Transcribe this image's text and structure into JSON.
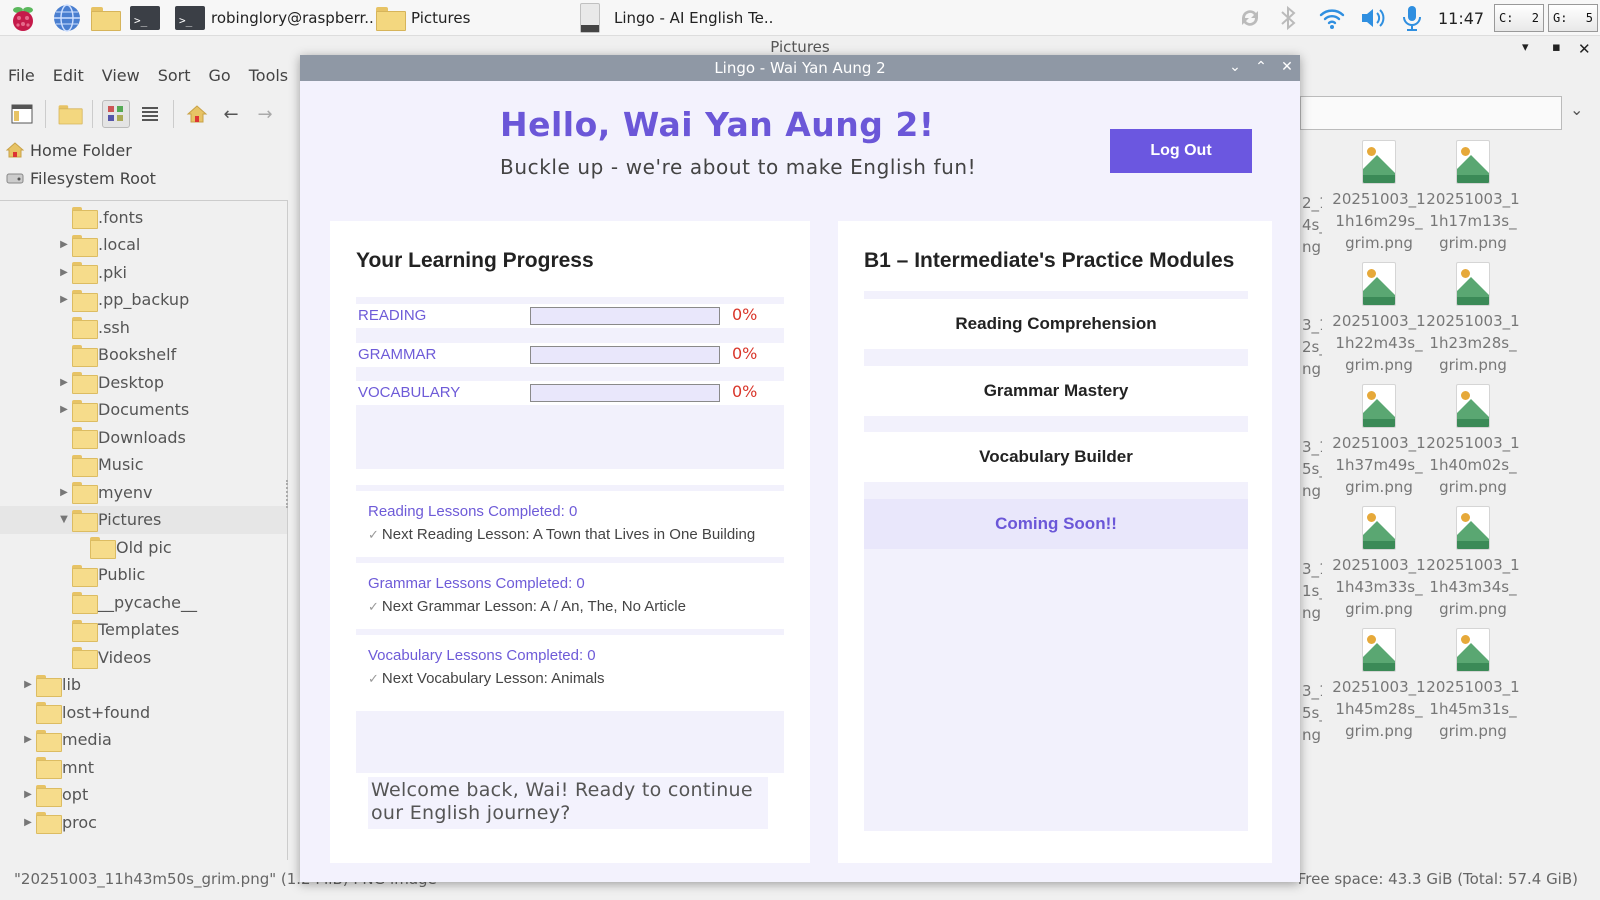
{
  "taskbar": {
    "terminal_label": "robinglory@raspberr..",
    "pictures_label": "Pictures",
    "lingo_label": "Lingo - AI English Te..",
    "clock": "11:47",
    "cpu_label": "C:",
    "cpu_value": "2",
    "gpu_label": "G:",
    "gpu_value": "5"
  },
  "file_manager": {
    "title": "Pictures",
    "menu": [
      "File",
      "Edit",
      "View",
      "Sort",
      "Go",
      "Tools"
    ],
    "places": [
      "Home Folder",
      "Filesystem Root"
    ],
    "tree": [
      {
        "label": ".fonts",
        "indent": 2,
        "expandable": false
      },
      {
        "label": ".local",
        "indent": 2,
        "expandable": true
      },
      {
        "label": ".pki",
        "indent": 2,
        "expandable": true
      },
      {
        "label": ".pp_backup",
        "indent": 2,
        "expandable": true
      },
      {
        "label": ".ssh",
        "indent": 2,
        "expandable": false
      },
      {
        "label": "Bookshelf",
        "indent": 2,
        "expandable": false
      },
      {
        "label": "Desktop",
        "indent": 2,
        "expandable": true
      },
      {
        "label": "Documents",
        "indent": 2,
        "expandable": true
      },
      {
        "label": "Downloads",
        "indent": 2,
        "expandable": false
      },
      {
        "label": "Music",
        "indent": 2,
        "expandable": false
      },
      {
        "label": "myenv",
        "indent": 2,
        "expandable": true
      },
      {
        "label": "Pictures",
        "indent": 2,
        "expandable": true,
        "expanded": true,
        "selected": true
      },
      {
        "label": "Old pic",
        "indent": 3,
        "expandable": false
      },
      {
        "label": "Public",
        "indent": 2,
        "expandable": false
      },
      {
        "label": "__pycache__",
        "indent": 2,
        "expandable": false
      },
      {
        "label": "Templates",
        "indent": 2,
        "expandable": false
      },
      {
        "label": "Videos",
        "indent": 2,
        "expandable": false
      },
      {
        "label": "lib",
        "indent": 1,
        "expandable": true
      },
      {
        "label": "lost+found",
        "indent": 1,
        "expandable": false
      },
      {
        "label": "media",
        "indent": 1,
        "expandable": true
      },
      {
        "label": "mnt",
        "indent": 1,
        "expandable": false
      },
      {
        "label": "opt",
        "indent": 1,
        "expandable": true
      },
      {
        "label": "proc",
        "indent": 1,
        "expandable": true
      }
    ],
    "files": [
      [
        "20251003_1",
        "1h16m29s_",
        "grim.png"
      ],
      [
        "20251003_1",
        "1h17m13s_",
        "grim.png"
      ],
      [
        "20251003_1",
        "1h22m43s_",
        "grim.png"
      ],
      [
        "20251003_1",
        "1h23m28s_",
        "grim.png"
      ],
      [
        "20251003_1",
        "1h37m49s_",
        "grim.png"
      ],
      [
        "20251003_1",
        "1h40m02s_",
        "grim.png"
      ],
      [
        "20251003_1",
        "1h43m33s_",
        "grim.png"
      ],
      [
        "20251003_1",
        "1h43m34s_",
        "grim.png"
      ],
      [
        "20251003_1",
        "1h45m28s_",
        "grim.png"
      ],
      [
        "20251003_1",
        "1h45m31s_",
        "grim.png"
      ]
    ],
    "partial_files": [
      [
        "2_1",
        "4s_",
        "ng"
      ],
      [
        "3_1",
        "2s_",
        "ng"
      ],
      [
        "3_1",
        "5s_",
        "ng"
      ],
      [
        "3_1",
        "1s_",
        "ng"
      ],
      [
        "3_1",
        "5s_",
        "ng"
      ]
    ],
    "status": "\"20251003_11h43m50s_grim.png\" (1.2 MiB) PNG image",
    "free_space": "Free space: 43.3 GiB (Total: 57.4 GiB)"
  },
  "lingo": {
    "window_title": "Lingo - Wai Yan Aung 2",
    "greeting": "Hello, Wai Yan Aung 2!",
    "tagline": "Buckle up - we're about to make English fun!",
    "logout_label": "Log Out",
    "progress_title": "Your Learning Progress",
    "progress": [
      {
        "label": "READING",
        "value": "0%",
        "fraction": 0
      },
      {
        "label": "GRAMMAR",
        "value": "0%",
        "fraction": 0
      },
      {
        "label": "VOCABULARY",
        "value": "0%",
        "fraction": 0
      }
    ],
    "lessons": [
      {
        "completed": "Reading Lessons Completed: 0",
        "next": "Next Reading Lesson: A Town that Lives in One Building"
      },
      {
        "completed": "Grammar Lessons Completed: 0",
        "next": "Next Grammar Lesson: A / An, The, No Article"
      },
      {
        "completed": "Vocabulary Lessons Completed: 0",
        "next": "Next Vocabulary Lesson: Animals"
      }
    ],
    "welcome_message": "Welcome back, Wai! Ready to continue our English journey?",
    "modules_title": "B1 – Intermediate's Practice Modules",
    "modules": [
      "Reading Comprehension",
      "Grammar Mastery",
      "Vocabulary Builder"
    ],
    "coming_soon": "Coming Soon!!"
  },
  "colors": {
    "accent": "#6b57e0",
    "accent_text": "#6e5bd8",
    "percent": "#d9362b",
    "panel_bg": "#f2f1fc"
  }
}
